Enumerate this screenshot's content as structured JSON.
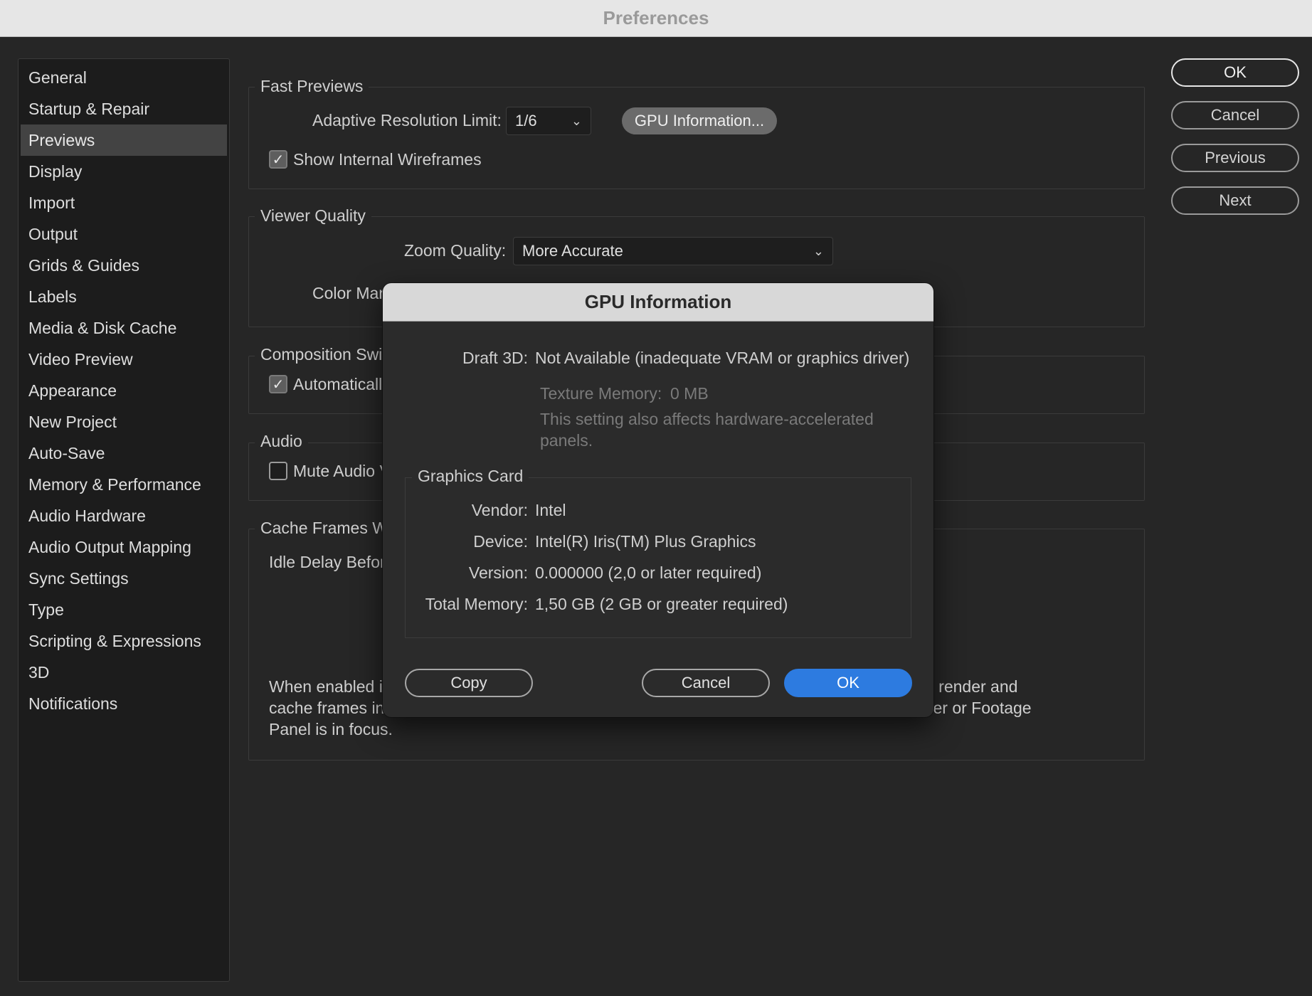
{
  "window": {
    "title": "Preferences"
  },
  "sidebar": {
    "items": [
      {
        "label": "General"
      },
      {
        "label": "Startup & Repair"
      },
      {
        "label": "Previews",
        "selected": true
      },
      {
        "label": "Display"
      },
      {
        "label": "Import"
      },
      {
        "label": "Output"
      },
      {
        "label": "Grids & Guides"
      },
      {
        "label": "Labels"
      },
      {
        "label": "Media & Disk Cache"
      },
      {
        "label": "Video Preview"
      },
      {
        "label": "Appearance"
      },
      {
        "label": "New Project"
      },
      {
        "label": "Auto-Save"
      },
      {
        "label": "Memory & Performance"
      },
      {
        "label": "Audio Hardware"
      },
      {
        "label": "Audio Output Mapping"
      },
      {
        "label": "Sync Settings"
      },
      {
        "label": "Type"
      },
      {
        "label": "Scripting & Expressions"
      },
      {
        "label": "3D"
      },
      {
        "label": "Notifications"
      }
    ]
  },
  "actions": {
    "ok": "OK",
    "cancel": "Cancel",
    "previous": "Previous",
    "next": "Next"
  },
  "fast_previews": {
    "title": "Fast Previews",
    "adaptive_label": "Adaptive Resolution Limit:",
    "adaptive_value": "1/6",
    "gpu_button": "GPU Information...",
    "wireframes_label": "Show Internal Wireframes",
    "wireframes_checked": true
  },
  "viewer_quality": {
    "title": "Viewer Quality",
    "zoom_label": "Zoom Quality:",
    "zoom_value": "More Accurate",
    "color_label_partial": "Color Man"
  },
  "composition_switching": {
    "title_partial": "Composition Swit",
    "auto_label_partial": "Automaticall",
    "auto_checked": true
  },
  "audio": {
    "title": "Audio",
    "mute_label_partial": "Mute Audio V",
    "mute_checked": false
  },
  "cache_frames": {
    "title_partial": "Cache Frames Wh",
    "idle_label_partial": "Idle Delay Befor",
    "desc_left": [
      "When enabled in",
      "cache frames in",
      "Panel is in focus."
    ],
    "desc_right": [
      "o render and",
      "yer or Footage"
    ]
  },
  "gpu_dialog": {
    "title": "GPU Information",
    "draft3d_label": "Draft 3D:",
    "draft3d_value": "Not Available (inadequate VRAM or graphics driver)",
    "texture_label": "Texture Memory:",
    "texture_value": "0 MB",
    "note_line1": "This setting also affects hardware-accelerated",
    "note_line2": "panels.",
    "graphics_card_title": "Graphics Card",
    "vendor_label": "Vendor:",
    "vendor_value": "Intel",
    "device_label": "Device:",
    "device_value": "Intel(R) Iris(TM) Plus Graphics",
    "version_label": "Version:",
    "version_value": "0.000000 (2,0 or later required)",
    "memory_label": "Total Memory:",
    "memory_value": "1,50 GB (2 GB or greater required)",
    "copy_button": "Copy",
    "cancel_button": "Cancel",
    "ok_button": "OK"
  },
  "colors": {
    "background": "#262626",
    "sidebar": "#1c1c1c",
    "selected": "#434343",
    "accent_blue": "#2d7be0",
    "title_bar": "#e6e6e6"
  }
}
